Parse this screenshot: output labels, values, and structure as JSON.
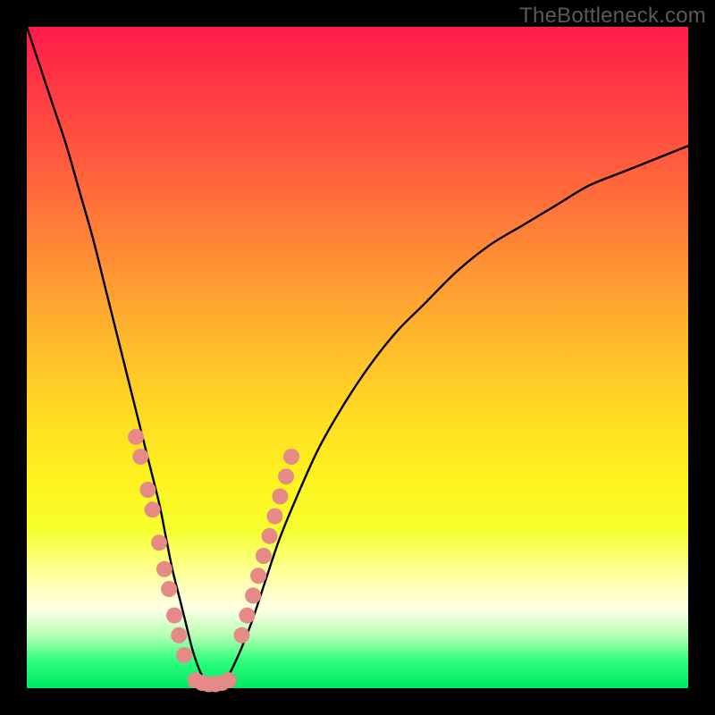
{
  "watermark": "TheBottleneck.com",
  "colors": {
    "curve_stroke": "#000000",
    "dot_fill": "#e58a86",
    "dot_stroke": "#b85a56"
  },
  "chart_data": {
    "type": "line",
    "title": "",
    "xlabel": "",
    "ylabel": "",
    "xlim": [
      0,
      100
    ],
    "ylim": [
      0,
      100
    ],
    "grid": false,
    "legend": false,
    "series": [
      {
        "name": "bottleneck-curve",
        "x": [
          0,
          2,
          4,
          6,
          8,
          10,
          12,
          14,
          16,
          18,
          20,
          21,
          22,
          23,
          24,
          25,
          26,
          27,
          28,
          29,
          30,
          32,
          34,
          36,
          38,
          40,
          44,
          48,
          52,
          56,
          60,
          65,
          70,
          75,
          80,
          85,
          90,
          95,
          100
        ],
        "y": [
          100,
          94,
          88,
          82,
          75,
          68,
          60,
          52,
          44,
          36,
          28,
          23,
          18,
          14,
          10,
          6,
          3,
          1,
          0,
          0,
          1,
          5,
          10,
          16,
          22,
          27,
          36,
          43,
          49,
          54,
          58,
          63,
          67,
          70,
          73,
          76,
          78,
          80,
          82
        ]
      }
    ],
    "annotations": {
      "dot_clusters": [
        {
          "name": "left-slope-dots",
          "points": [
            {
              "x": 16.5,
              "y": 38
            },
            {
              "x": 17.2,
              "y": 35
            },
            {
              "x": 18.3,
              "y": 30
            },
            {
              "x": 19.0,
              "y": 27
            },
            {
              "x": 20.0,
              "y": 22
            },
            {
              "x": 20.8,
              "y": 18
            },
            {
              "x": 21.5,
              "y": 15
            },
            {
              "x": 22.3,
              "y": 11
            },
            {
              "x": 23.0,
              "y": 8
            },
            {
              "x": 23.8,
              "y": 5
            }
          ]
        },
        {
          "name": "trough-dots",
          "points": [
            {
              "x": 25.5,
              "y": 1.2
            },
            {
              "x": 26.5,
              "y": 0.8
            },
            {
              "x": 27.5,
              "y": 0.6
            },
            {
              "x": 28.5,
              "y": 0.6
            },
            {
              "x": 29.5,
              "y": 0.8
            },
            {
              "x": 30.5,
              "y": 1.2
            }
          ]
        },
        {
          "name": "right-slope-dots",
          "points": [
            {
              "x": 32.5,
              "y": 8
            },
            {
              "x": 33.3,
              "y": 11
            },
            {
              "x": 34.2,
              "y": 14
            },
            {
              "x": 35.0,
              "y": 17
            },
            {
              "x": 35.8,
              "y": 20
            },
            {
              "x": 36.7,
              "y": 23
            },
            {
              "x": 37.5,
              "y": 26
            },
            {
              "x": 38.3,
              "y": 29
            },
            {
              "x": 39.2,
              "y": 32
            },
            {
              "x": 40.0,
              "y": 35
            }
          ]
        }
      ]
    }
  }
}
